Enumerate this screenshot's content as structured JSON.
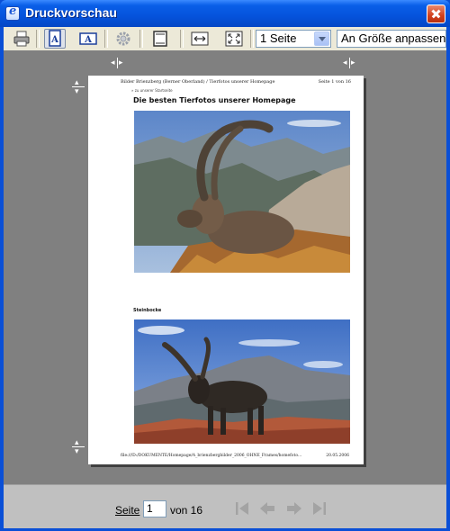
{
  "window": {
    "title": "Druckvorschau"
  },
  "toolbar": {
    "buttons": [
      {
        "name": "print-button",
        "icon": "printer-icon"
      },
      {
        "name": "portrait-button",
        "icon": "portrait-page-icon",
        "pressed": true
      },
      {
        "name": "landscape-button",
        "icon": "landscape-page-icon"
      },
      {
        "name": "page-setup-button",
        "icon": "gear-icon"
      },
      {
        "name": "header-footer-button",
        "icon": "header-footer-icon"
      },
      {
        "name": "full-width-button",
        "icon": "full-width-icon"
      },
      {
        "name": "full-page-button",
        "icon": "full-page-icon"
      }
    ],
    "pages_select": "1 Seite",
    "zoom_select": "An Größe anpassen"
  },
  "page_content": {
    "header_left": "Bilder Brienzberg (Berner Oberland) / Tierfotos unserer Homepage",
    "header_right": "Seite 1 von 16",
    "breadcrumb": "» zu unserer Startseite",
    "title": "Die besten Tierfotos unserer Homepage",
    "caption": "Steinbocke",
    "footer_left": "file:///D:/DOKUMENTE/Homepage/A_brienzbergbilder_2006_OHNE_Frames/homefoto...",
    "footer_right": "20.05.2006"
  },
  "status": {
    "page_label": "Seite",
    "page_value": "1",
    "of_label": "von 16"
  },
  "colors": {
    "titlebar": "#0553dc",
    "client_bg": "#ece9d8",
    "preview_bg": "#808080",
    "statusbar_bg": "#c0c0c0"
  }
}
